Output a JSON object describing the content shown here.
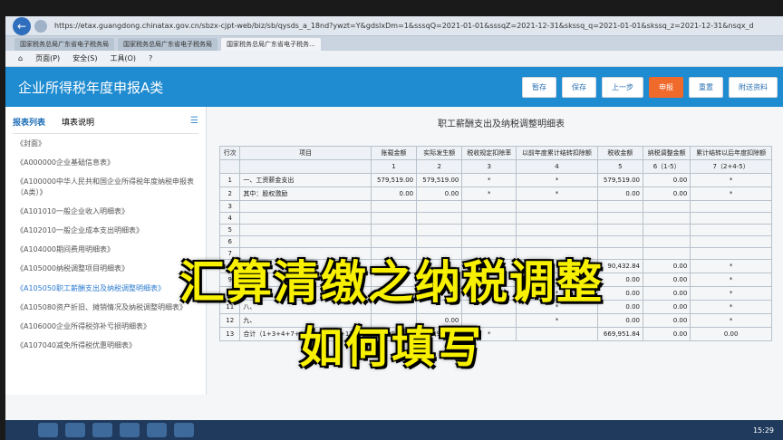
{
  "browser": {
    "url": "https://etax.guangdong.chinatax.gov.cn/sbzx-cjpt-web/biz/sb/qysds_a_18nd?ywzt=Y&gdslxDm=1&sssqQ=2021-01-01&sssqZ=2021-12-31&skssq_q=2021-01-01&skssq_z=2021-12-31&nsqx_d",
    "tabs": [
      "国家税务总局广东省电子税务局",
      "国家税务总局广东省电子税务局",
      "国家税务总局广东省电子税务..."
    ],
    "menu": [
      "页面(P)",
      "安全(S)",
      "工具(O)",
      "?"
    ]
  },
  "app": {
    "title": "企业所得税年度申报A类",
    "buttons": [
      "暂存",
      "保存",
      "上一步",
      "申报",
      "重置",
      "附送资料"
    ]
  },
  "sidebar": {
    "tabs": [
      "报表列表",
      "填表说明"
    ],
    "items": [
      "《封面》",
      "《A000000企业基础信息表》",
      "《A100000中华人民共和国企业所得税年度纳税申报表（A类）》",
      "《A101010一般企业收入明细表》",
      "《A102010一般企业成本支出明细表》",
      "《A104000期间费用明细表》",
      "《A105000纳税调整项目明细表》",
      "《A105050职工薪酬支出及纳税调整明细表》",
      "《A105080资产折旧、摊销情况及纳税调整明细表》",
      "《A106000企业所得税弥补亏损明细表》",
      "《A107040减免所得税优惠明细表》"
    ],
    "selected_index": 7
  },
  "sheet": {
    "title": "职工薪酬支出及纳税调整明细表",
    "headers": [
      "行次",
      "项目",
      "账载金额",
      "实际发生额",
      "税收规定扣除率",
      "以前年度累计结转扣除额",
      "税收金额",
      "纳税调整金额",
      "累计结转以后年度扣除额"
    ],
    "col_numbers": [
      "",
      "",
      "1",
      "2",
      "3",
      "4",
      "5",
      "6（1-5）",
      "7（2+4-5）"
    ],
    "rows": [
      [
        "1",
        "一、工资薪金支出",
        "579,519.00",
        "579,519.00",
        "*",
        "*",
        "579,519.00",
        "0.00",
        "*"
      ],
      [
        "2",
        "其中：股权激励",
        "0.00",
        "0.00",
        "*",
        "*",
        "0.00",
        "0.00",
        "*"
      ],
      [
        "3",
        "",
        "",
        "",
        "",
        "",
        "",
        "",
        ""
      ],
      [
        "4",
        "",
        "",
        "",
        "",
        "",
        "",
        "",
        ""
      ],
      [
        "5",
        "",
        "",
        "",
        "",
        "",
        "",
        "",
        ""
      ],
      [
        "6",
        "",
        "",
        "",
        "",
        "",
        "",
        "",
        ""
      ],
      [
        "7",
        "",
        "",
        "",
        "",
        "",
        "",
        "",
        ""
      ],
      [
        "8",
        "五、",
        "",
        "",
        "",
        "*",
        "90,432.84",
        "0.00",
        "*"
      ],
      [
        "9",
        "六、",
        "",
        "",
        "",
        "*",
        "0.00",
        "0.00",
        "*"
      ],
      [
        "10",
        "七、",
        "",
        "",
        "",
        "*",
        "0.00",
        "0.00",
        "*"
      ],
      [
        "11",
        "八、",
        "",
        "",
        "",
        "*",
        "0.00",
        "0.00",
        "*"
      ],
      [
        "12",
        "九、",
        "",
        "0.00",
        "",
        "*",
        "0.00",
        "0.00",
        "*"
      ],
      [
        "13",
        "合计（1+3+4+7+8+9+10+11+12）",
        "669,951.84",
        "669,951.84",
        "*",
        "",
        "669,951.84",
        "0.00",
        "0.00"
      ]
    ]
  },
  "caption": {
    "line1": "汇算清缴之纳税调整",
    "line2": "如何填写"
  },
  "taskbar": {
    "clock": "15:29"
  }
}
